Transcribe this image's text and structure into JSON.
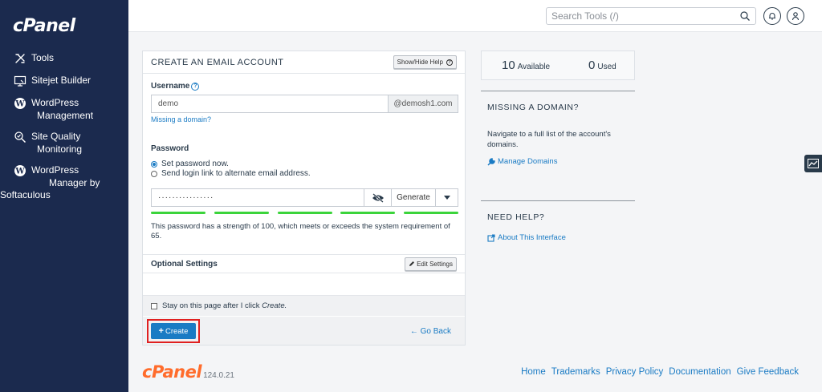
{
  "sidebar": {
    "logo": "cPanel",
    "items": [
      {
        "label": "Tools",
        "sub": "",
        "icon": "tools-icon"
      },
      {
        "label": "Sitejet Builder",
        "sub": "",
        "icon": "monitor-icon"
      },
      {
        "label": "WordPress",
        "sub": "Management",
        "icon": "wordpress-icon"
      },
      {
        "label": "Site Quality",
        "sub": "Monitoring",
        "icon": "magnifier-icon"
      },
      {
        "label": "WordPress",
        "sub": "Manager by",
        "sub2": "Softaculous",
        "icon": "wordpress-icon"
      }
    ]
  },
  "header": {
    "search_placeholder": "Search Tools (/)"
  },
  "form": {
    "title": "CREATE AN EMAIL ACCOUNT",
    "help_toggle": "Show/Hide Help",
    "username_label": "Username",
    "username_value": "demo",
    "domain_suffix": "@demosh1.com",
    "missing_domain_link": "Missing a domain?",
    "password_label": "Password",
    "radio_set_now": "Set password now.",
    "radio_send_link": "Send login link to alternate email address.",
    "password_value": "················",
    "generate_label": "Generate",
    "strength_bars": 5,
    "strength_text": "This password has a strength of 100, which meets or exceeds the system requirement of 65.",
    "optional_settings": "Optional Settings",
    "edit_settings": "Edit Settings",
    "stay_text": "Stay on this page after I click",
    "stay_em": "Create.",
    "create_label": "Create",
    "go_back": "Go Back"
  },
  "stats": {
    "available_count": "10",
    "available_label": "Available",
    "used_count": "0",
    "used_label": "Used"
  },
  "missing_domain": {
    "title": "MISSING A DOMAIN?",
    "text": "Navigate to a full list of the account's domains.",
    "link": "Manage Domains"
  },
  "need_help": {
    "title": "NEED HELP?",
    "link": "About This Interface"
  },
  "footer": {
    "logo": "cPanel",
    "version": "124.0.21",
    "links": [
      "Home",
      "Trademarks",
      "Privacy Policy",
      "Documentation",
      "Give Feedback"
    ]
  },
  "colors": {
    "sidebar": "#1b2a4e",
    "accent": "#1a7bc4",
    "strength": "#3bd43b",
    "highlight": "#e02020",
    "brand_orange": "#ff6c2c"
  }
}
